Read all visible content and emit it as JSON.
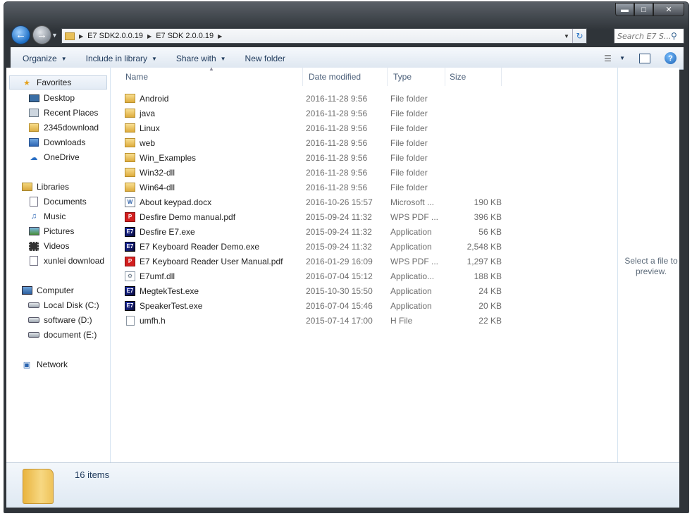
{
  "address": {
    "crumbs": [
      "E7 SDK2.0.0.19",
      "E7 SDK 2.0.0.19"
    ],
    "search_placeholder": "Search E7 S..."
  },
  "toolbar": {
    "organize": "Organize",
    "include": "Include in library",
    "share": "Share with",
    "new_folder": "New folder"
  },
  "sidebar": {
    "favorites": {
      "label": "Favorites",
      "items": [
        "Desktop",
        "Recent Places",
        "2345download",
        "Downloads",
        "OneDrive"
      ]
    },
    "libraries": {
      "label": "Libraries",
      "items": [
        "Documents",
        "Music",
        "Pictures",
        "Videos",
        "xunlei download"
      ]
    },
    "computer": {
      "label": "Computer",
      "items": [
        "Local Disk (C:)",
        "software (D:)",
        "document (E:)"
      ]
    },
    "network": {
      "label": "Network"
    }
  },
  "columns": [
    "Name",
    "Date modified",
    "Type",
    "Size"
  ],
  "files": [
    {
      "name": "Android",
      "date": "2016-11-28 9:56",
      "type": "File folder",
      "size": "",
      "icon": "folder"
    },
    {
      "name": "java",
      "date": "2016-11-28 9:56",
      "type": "File folder",
      "size": "",
      "icon": "folder"
    },
    {
      "name": "Linux",
      "date": "2016-11-28 9:56",
      "type": "File folder",
      "size": "",
      "icon": "folder"
    },
    {
      "name": "web",
      "date": "2016-11-28 9:56",
      "type": "File folder",
      "size": "",
      "icon": "folder"
    },
    {
      "name": "Win_Examples",
      "date": "2016-11-28 9:56",
      "type": "File folder",
      "size": "",
      "icon": "folder"
    },
    {
      "name": "Win32-dll",
      "date": "2016-11-28 9:56",
      "type": "File folder",
      "size": "",
      "icon": "folder"
    },
    {
      "name": "Win64-dll",
      "date": "2016-11-28 9:56",
      "type": "File folder",
      "size": "",
      "icon": "folder"
    },
    {
      "name": "About keypad.docx",
      "date": "2016-10-26 15:57",
      "type": "Microsoft ...",
      "size": "190 KB",
      "icon": "docx"
    },
    {
      "name": "Desfire Demo manual.pdf",
      "date": "2015-09-24 11:32",
      "type": "WPS PDF ...",
      "size": "396 KB",
      "icon": "pdf"
    },
    {
      "name": "Desfire E7.exe",
      "date": "2015-09-24 11:32",
      "type": "Application",
      "size": "56 KB",
      "icon": "exe"
    },
    {
      "name": "E7 Keyboard Reader Demo.exe",
      "date": "2015-09-24 11:32",
      "type": "Application",
      "size": "2,548 KB",
      "icon": "exe"
    },
    {
      "name": "E7 Keyboard Reader User Manual.pdf",
      "date": "2016-01-29 16:09",
      "type": "WPS PDF ...",
      "size": "1,297 KB",
      "icon": "pdf"
    },
    {
      "name": "E7umf.dll",
      "date": "2016-07-04 15:12",
      "type": "Applicatio...",
      "size": "188 KB",
      "icon": "dll"
    },
    {
      "name": "MegtekTest.exe",
      "date": "2015-10-30 15:50",
      "type": "Application",
      "size": "24 KB",
      "icon": "exe"
    },
    {
      "name": "SpeakerTest.exe",
      "date": "2016-07-04 15:46",
      "type": "Application",
      "size": "20 KB",
      "icon": "exe"
    },
    {
      "name": "umfh.h",
      "date": "2015-07-14 17:00",
      "type": "H File",
      "size": "22 KB",
      "icon": "h"
    }
  ],
  "preview": {
    "text": "Select a file to preview."
  },
  "status": {
    "count": "16 items"
  }
}
